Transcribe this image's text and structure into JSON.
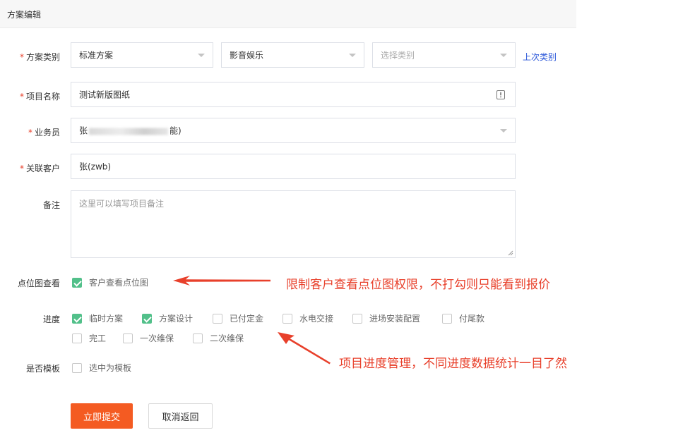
{
  "header": {
    "title": "方案编辑"
  },
  "form": {
    "scheme_type": {
      "label": "方案类别",
      "select1_value": "标准方案",
      "select2_value": "影音娱乐",
      "select3_placeholder": "选择类别",
      "last_type_link": "上次类别"
    },
    "project_name": {
      "label": "项目名称",
      "value": "测试新版图纸"
    },
    "salesperson": {
      "label": "业务员",
      "value_prefix": "张",
      "value_suffix": "能)"
    },
    "customer": {
      "label": "关联客户",
      "value": "张(zwb)"
    },
    "remark": {
      "label": "备注",
      "placeholder": "这里可以填写项目备注"
    },
    "point_view": {
      "label": "点位图查看",
      "checkbox_label": "客户查看点位图"
    },
    "progress": {
      "label": "进度",
      "items": [
        {
          "label": "临时方案",
          "checked": true
        },
        {
          "label": "方案设计",
          "checked": true
        },
        {
          "label": "已付定金",
          "checked": false
        },
        {
          "label": "水电交接",
          "checked": false
        },
        {
          "label": "进场安装配置",
          "checked": false
        },
        {
          "label": "付尾款",
          "checked": false
        },
        {
          "label": "完工",
          "checked": false
        },
        {
          "label": "一次维保",
          "checked": false
        },
        {
          "label": "二次维保",
          "checked": false
        }
      ]
    },
    "template": {
      "label": "是否模板",
      "checkbox_label": "选中为模板"
    }
  },
  "annotations": {
    "point_view_note": "限制客户查看点位图权限，不打勾则只能看到报价",
    "progress_note": "项目进度管理，不同进度数据统计一目了然"
  },
  "buttons": {
    "submit": "立即提交",
    "cancel": "取消返回"
  },
  "colors": {
    "primary": "#f45b22",
    "checkbox_checked": "#52c08a",
    "link": "#2b57d9",
    "annotation": "#e8402b"
  }
}
